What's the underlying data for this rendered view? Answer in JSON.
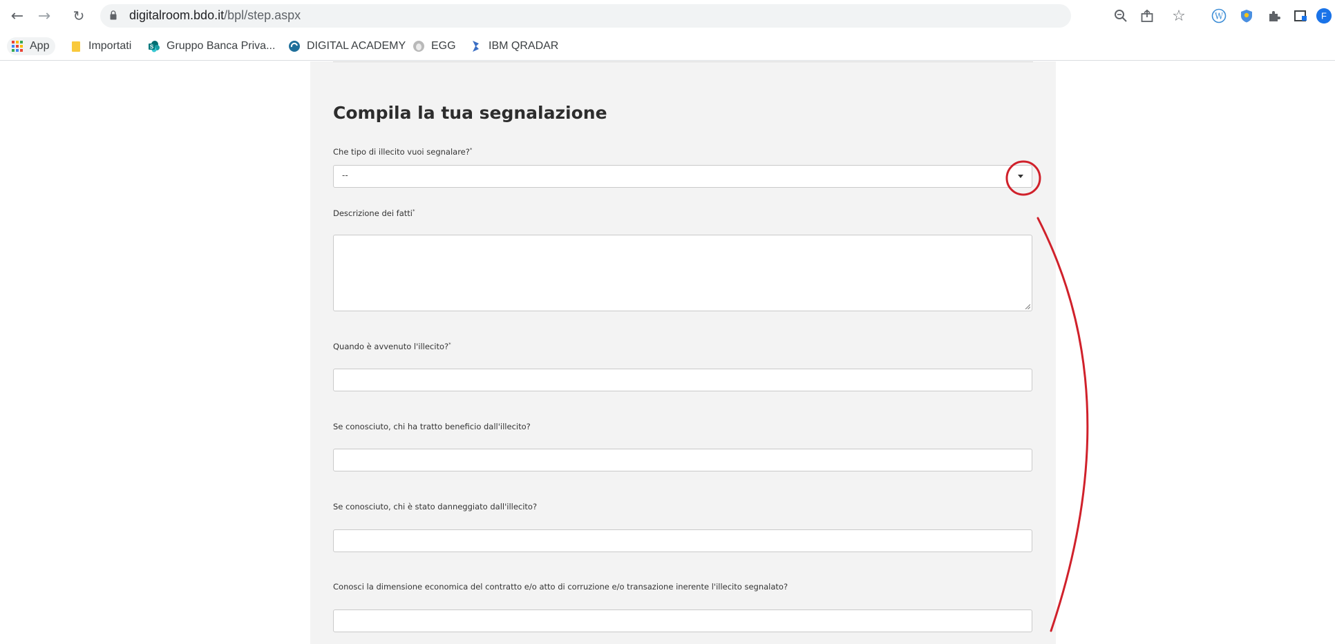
{
  "browser": {
    "url_domain": "digitalroom.bdo.it",
    "url_path": "/bpl/step.aspx",
    "profile_initial": "F",
    "bookmarks": [
      {
        "label": "App",
        "icon": "apps-grid-icon"
      },
      {
        "label": "Importati",
        "icon": "folder-icon"
      },
      {
        "label": "Gruppo Banca Priva...",
        "icon": "sharepoint-icon"
      },
      {
        "label": "DIGITAL ACADEMY",
        "icon": "academy-icon"
      },
      {
        "label": "EGG",
        "icon": "egg-icon"
      },
      {
        "label": "IBM QRADAR",
        "icon": "qradar-icon"
      }
    ]
  },
  "form": {
    "title": "Compila la tua segnalazione",
    "fields": [
      {
        "label": "Che tipo di illecito vuoi segnalare?",
        "required": "*",
        "type": "select",
        "value": "--"
      },
      {
        "label": "Descrizione dei fatti",
        "required": "*",
        "type": "textarea",
        "value": ""
      },
      {
        "label": "Quando è avvenuto l'illecito?",
        "required": "*",
        "type": "text",
        "value": ""
      },
      {
        "label": "Se conosciuto, chi ha tratto beneficio dall'illecito?",
        "required": "",
        "type": "text",
        "value": ""
      },
      {
        "label": "Se conosciuto, chi è stato danneggiato  dall'illecito?",
        "required": "",
        "type": "text",
        "value": ""
      },
      {
        "label": "Conosci la dimensione economica del contratto e/o atto di corruzione e/o transazione inerente l'illecito segnalato?",
        "required": "",
        "type": "text",
        "value": ""
      }
    ]
  },
  "colors": {
    "annotation_red": "#d0212b",
    "panel_bg": "#f3f3f3",
    "profile_blue": "#1a73e8"
  }
}
